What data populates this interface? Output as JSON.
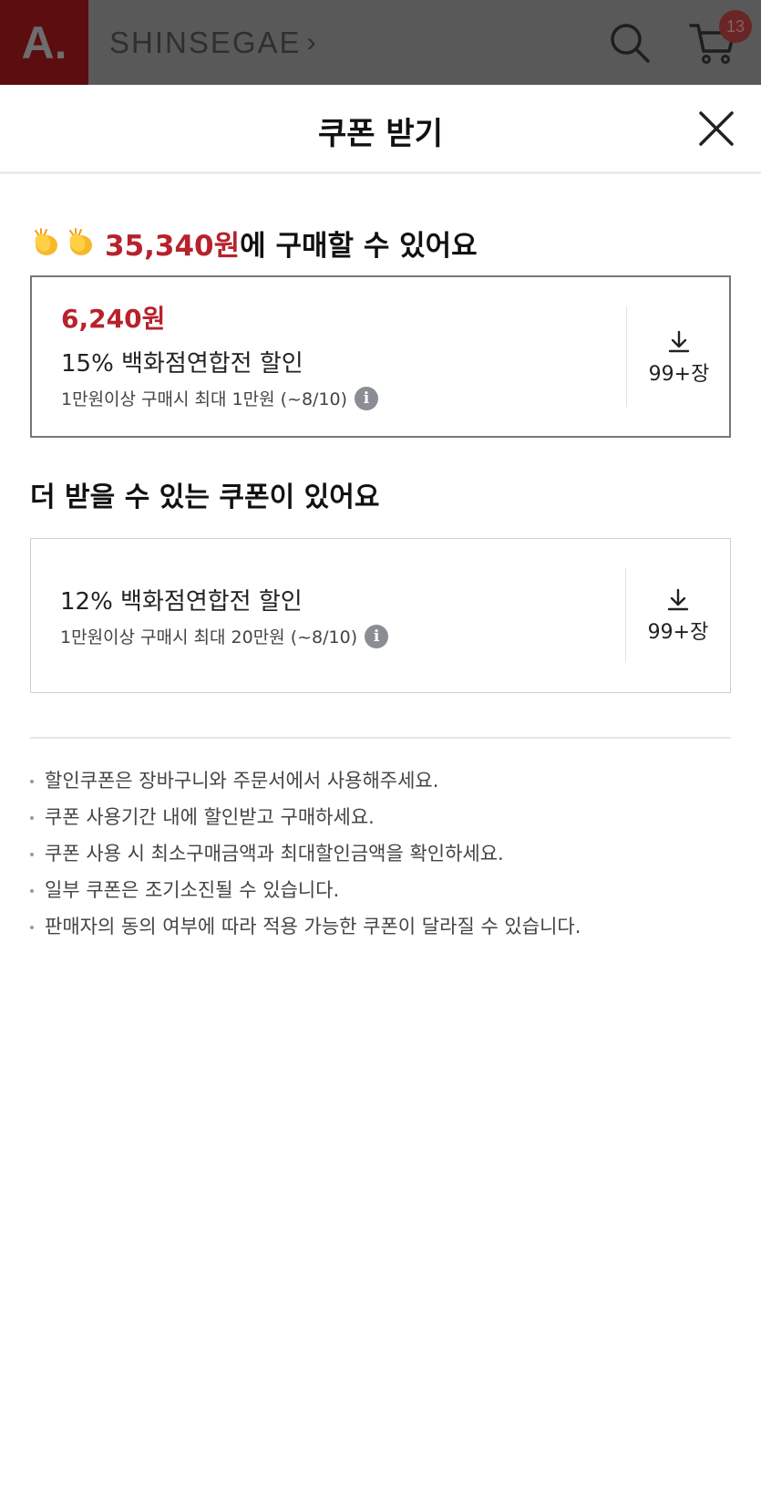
{
  "header": {
    "logo_text": "A.",
    "brand": "SHINSEGAE",
    "brand_chevron": "›",
    "search_icon": "search-icon",
    "cart_icon": "cart-icon",
    "cart_count": "13"
  },
  "sheet": {
    "title": "쿠폰 받기",
    "close_icon": "close-icon"
  },
  "summary": {
    "emoji": "clapping-hands",
    "price": "35,340원",
    "suffix": "에 구매할 수 있어요"
  },
  "applied_coupon": {
    "amount": "6,240원",
    "name": "15% 백화점연합전 할인",
    "condition": "1만원이상 구매시 최대 1만원 (~8/10)",
    "info_icon": "i",
    "download_label": "99+장"
  },
  "more_section": {
    "title": "더 받을 수 있는 쿠폰이 있어요"
  },
  "more_coupon": {
    "name": "12% 백화점연합전 할인",
    "condition": "1만원이상 구매시 최대 20만원 (~8/10)",
    "info_icon": "i",
    "download_label": "99+장"
  },
  "notes": [
    "할인쿠폰은 장바구니와 주문서에서 사용해주세요.",
    "쿠폰 사용기간 내에 할인받고 구매하세요.",
    "쿠폰 사용 시 최소구매금액과 최대할인금액을 확인하세요.",
    "일부 쿠폰은 조기소진될 수 있습니다.",
    "판매자의 동의 여부에 따라 적용 가능한 쿠폰이 달라질 수 있습니다."
  ],
  "colors": {
    "accent_red": "#b7222c",
    "overlay_gray": "#595959"
  }
}
